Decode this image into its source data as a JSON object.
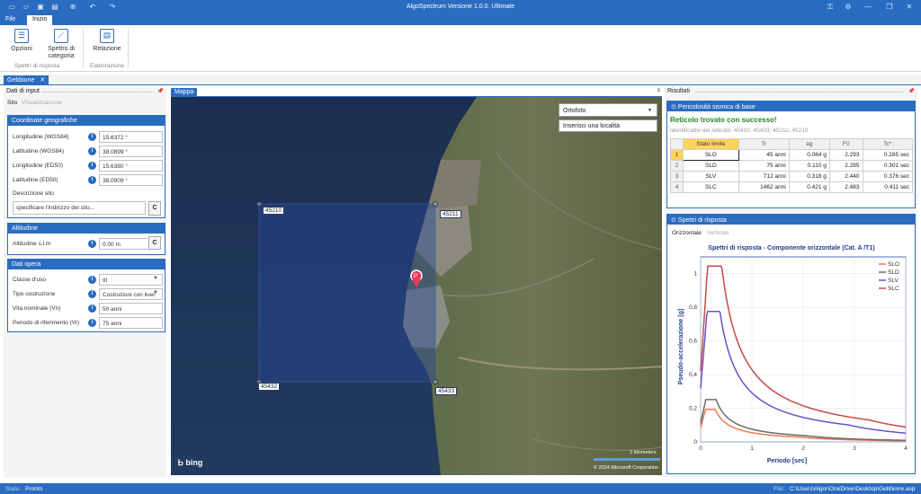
{
  "titlebar": {
    "title": "AlgoSpectrum Versione 1.0.0. Ultimate"
  },
  "menu": {
    "file": "File",
    "inizio": "Inizio"
  },
  "ribbon": {
    "opzioni": "Opzioni",
    "spettro_line1": "Spettro di",
    "spettro_line2": "categoria",
    "relazione": "Relazione",
    "group_spettri": "Spettri di risposta",
    "group_elaborazione": "Elaborazione"
  },
  "doc_tab": {
    "label": "Gebbione",
    "close": "✕"
  },
  "left_panel": {
    "title": "Dati di input",
    "tab_sito": "Sito",
    "tab_visualizzazione": "Visualizzazione",
    "coord": {
      "title": "Coordinate geografiche",
      "lon_wgs_label": "Longitudine (WGS84)",
      "lon_wgs_value": "15.6372 °",
      "lat_wgs_label": "Latitudine (WGS84)",
      "lat_wgs_value": "38.0899 °",
      "lon_ed_label": "Longitudine (ED50)",
      "lon_ed_value": "15.6380 °",
      "lat_ed_label": "Latitudine (ED50)",
      "lat_ed_value": "38.0909 °",
      "desc_label": "Descrizione sito",
      "desc_placeholder": "specificare l'indirizzo del sito..."
    },
    "alt": {
      "title": "Altitudine",
      "label": "Altitudine s.l.m",
      "value": "0.00 m"
    },
    "opera": {
      "title": "Dati opera",
      "classe_label": "Classe d'uso",
      "classe_value": "III",
      "tipo_label": "Tipo costruzione",
      "tipo_value": "Costruzioni con livel",
      "vita_label": "Vita nominale (Vn)",
      "vita_value": "50 anni",
      "periodo_label": "Periodo di riferimento (Vr)",
      "periodo_value": "75 anni"
    },
    "c_button": "C"
  },
  "map": {
    "title": "Mappa",
    "layer": "Ortofoto",
    "search_placeholder": "Inserisci una località",
    "markers": [
      "45210",
      "45211",
      "45432",
      "45433"
    ],
    "bing": "bing",
    "scale": "2 kilometers",
    "copyright": "© 2024 Microsoft Corporation"
  },
  "results": {
    "title": "Risultati",
    "sismica": {
      "title": "Pericolosità sismica di base",
      "success": "Reticolo trovato con successo!",
      "ident": "Identificativi del reticolo: 45432; 45433; 45211; 45210",
      "headers": [
        "",
        "Stato limite",
        "Tr",
        "ag",
        "F0",
        "Tc*"
      ],
      "rows": [
        [
          "1",
          "SLO",
          "45 anni",
          "0.084 g",
          "2.293",
          "0.285 sec"
        ],
        [
          "2",
          "SLD",
          "75 anni",
          "0.110 g",
          "2.285",
          "0.301 sec"
        ],
        [
          "3",
          "SLV",
          "712 anni",
          "0.318 g",
          "2.440",
          "0.376 sec"
        ],
        [
          "4",
          "SLC",
          "1462 anni",
          "0.421 g",
          "2.483",
          "0.411 sec"
        ]
      ]
    },
    "spettri": {
      "title": "Spettri di risposta",
      "tab_orizzontale": "Orizzontale",
      "tab_verticale": "Verticale"
    }
  },
  "chart_data": {
    "type": "line",
    "title": "Spettri di risposta - Componente orizzontale (Cat. A /T1)",
    "xlabel": "Periodo [sec]",
    "ylabel": "Pseudo-accelerazione [g]",
    "xlim": [
      0,
      4
    ],
    "ylim": [
      0,
      1.1
    ],
    "xticks": [
      "0",
      "1",
      "2",
      "3",
      "4"
    ],
    "yticks": [
      "0",
      "0,2",
      "0,4",
      "0,6",
      "0,8",
      "1"
    ],
    "legend_position": "top-right",
    "grid": true,
    "series": [
      {
        "name": "SLO",
        "color": "#f07850",
        "ag": 0.084,
        "F0": 2.293,
        "Tc": 0.285
      },
      {
        "name": "SLD",
        "color": "#6a6a6a",
        "ag": 0.11,
        "F0": 2.285,
        "Tc": 0.301
      },
      {
        "name": "SLV",
        "color": "#6a50c8",
        "ag": 0.318,
        "F0": 2.44,
        "Tc": 0.376
      },
      {
        "name": "SLC",
        "color": "#c84848",
        "ag": 0.421,
        "F0": 2.483,
        "Tc": 0.411
      }
    ]
  },
  "status": {
    "label": "Stato:",
    "value": "Pronto",
    "file_label": "File:",
    "file_path": "C:\\Users\\Algor\\OneDrive\\Desktop\\Gebbione.asp"
  }
}
